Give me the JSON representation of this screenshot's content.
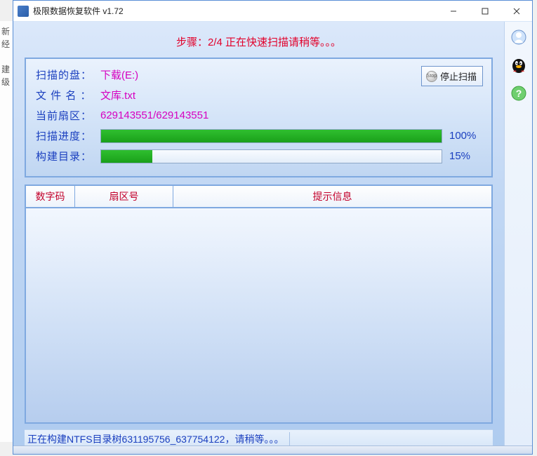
{
  "window": {
    "title": "极限数据恢复软件 v1.72"
  },
  "step_text": "步骤：2/4 正在快速扫描请稍等。。。",
  "stop_button": "停止扫描",
  "labels": {
    "disk": "扫描的盘：",
    "file": "文 件 名 ：",
    "sector": "当前扇区：",
    "scan_progress": "扫描进度：",
    "build_dir": "构建目录："
  },
  "values": {
    "disk": "下载(E:)",
    "file": "文库.txt",
    "sector": "629143551/629143551",
    "scan_pct": "100%",
    "build_pct": "15%"
  },
  "progress": {
    "scan": 100,
    "build": 15
  },
  "columns": {
    "c1": "数字码",
    "c2": "扇区号",
    "c3": "提示信息"
  },
  "status": "正在构建NTFS目录树631195756_637754122，请稍等。。。",
  "behind_text": "新\n经\n\n建\n级"
}
